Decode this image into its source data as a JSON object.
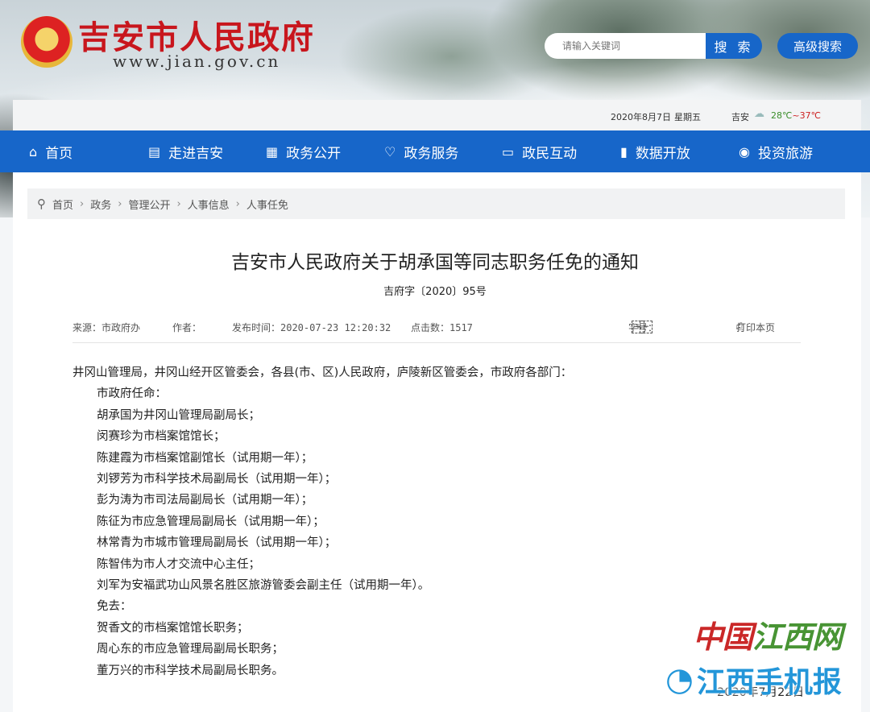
{
  "header": {
    "site_title": "吉安市人民政府",
    "site_url": "www.jian.gov.cn",
    "search_placeholder": "请输入关键词",
    "search_button": "搜 索",
    "advanced_button": "高级搜索"
  },
  "datebar": {
    "date": "2020年8月7日",
    "weekday": "星期五",
    "city": "吉安",
    "temp_low": "28℃",
    "temp_sep": "~",
    "temp_high": "37℃"
  },
  "nav": [
    {
      "label": "首页",
      "icon": "home-icon",
      "glyph": "⌂"
    },
    {
      "label": "走进吉安",
      "icon": "document-icon",
      "glyph": "▤"
    },
    {
      "label": "政务公开",
      "icon": "building-icon",
      "glyph": "▦"
    },
    {
      "label": "政务服务",
      "icon": "heart-hands-icon",
      "glyph": "♡"
    },
    {
      "label": "政民互动",
      "icon": "chat-icon",
      "glyph": "▭"
    },
    {
      "label": "数据开放",
      "icon": "bar-chart-icon",
      "glyph": "▮"
    },
    {
      "label": "投资旅游",
      "icon": "yen-icon",
      "glyph": "◉"
    }
  ],
  "breadcrumb": [
    "首页",
    "政务",
    "管理公开",
    "人事信息",
    "人事任免"
  ],
  "article": {
    "title": "吉安市人民政府关于胡承国等同志职务任免的通知",
    "doc_number": "吉府字〔2020〕95号",
    "meta": {
      "source": "来源：市政府办",
      "author": "作者：",
      "publish_time": "发布时间：2020-07-23 12:20:32",
      "clicks": "点击数：1517",
      "font_size_label": "字号：",
      "font_plus": "+",
      "font_minus": "−",
      "print": "打印本页"
    },
    "paragraphs": [
      {
        "text": "井冈山管理局，井冈山经开区管委会，各县(市、区)人民政府，庐陵新区管委会，市政府各部门：",
        "indent": false
      },
      {
        "text": "市政府任命：",
        "indent": true
      },
      {
        "text": "胡承国为井冈山管理局副局长；",
        "indent": true
      },
      {
        "text": "闵赛珍为市档案馆馆长；",
        "indent": true
      },
      {
        "text": "陈建霞为市档案馆副馆长（试用期一年）；",
        "indent": true
      },
      {
        "text": "刘锣芳为市科学技术局副局长（试用期一年）；",
        "indent": true
      },
      {
        "text": "彭为涛为市司法局副局长（试用期一年）；",
        "indent": true
      },
      {
        "text": "陈征为市应急管理局副局长（试用期一年）；",
        "indent": true
      },
      {
        "text": "林常青为市城市管理局副局长（试用期一年）；",
        "indent": true
      },
      {
        "text": "陈智伟为市人才交流中心主任；",
        "indent": true
      },
      {
        "text": "刘军为安福武功山风景名胜区旅游管委会副主任（试用期一年）。",
        "indent": true
      },
      {
        "text": "免去：",
        "indent": true
      },
      {
        "text": "贺香文的市档案馆馆长职务；",
        "indent": true
      },
      {
        "text": "周心东的市应急管理局副局长职务；",
        "indent": true
      },
      {
        "text": "董万兴的市科学技术局副局长职务。",
        "indent": true
      }
    ],
    "date": "2020年7月22日"
  },
  "watermark": {
    "line1_red": "中国",
    "line1_green": "江西网",
    "line2": "江西手机报"
  }
}
